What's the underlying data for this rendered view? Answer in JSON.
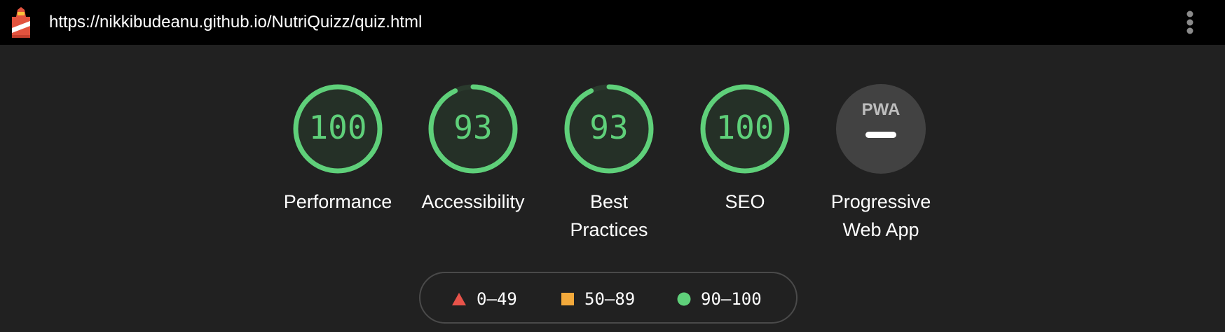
{
  "header": {
    "url": "https://nikkibudeanu.github.io/NutriQuizz/quiz.html",
    "logo_icon": "lighthouse-icon",
    "menu_icon": "kebab-menu-icon"
  },
  "colors": {
    "pass": "#5fd07a",
    "average": "#f2a93b",
    "fail": "#e8534a",
    "ring_bg": "#2a3a2d",
    "pwa_bg": "#424242"
  },
  "categories": [
    {
      "label": "Performance",
      "score": "100",
      "value": 100
    },
    {
      "label": "Accessibility",
      "score": "93",
      "value": 93
    },
    {
      "label": "Best Practices",
      "score": "93",
      "value": 93
    },
    {
      "label": "SEO",
      "score": "100",
      "value": 100
    }
  ],
  "pwa": {
    "label": "Progressive Web App",
    "badge": "PWA"
  },
  "legend": [
    {
      "range": "0–49",
      "shape": "triangle",
      "color": "#e8534a"
    },
    {
      "range": "50–89",
      "shape": "square",
      "color": "#f2a93b"
    },
    {
      "range": "90–100",
      "shape": "circle",
      "color": "#5fd07a"
    }
  ]
}
